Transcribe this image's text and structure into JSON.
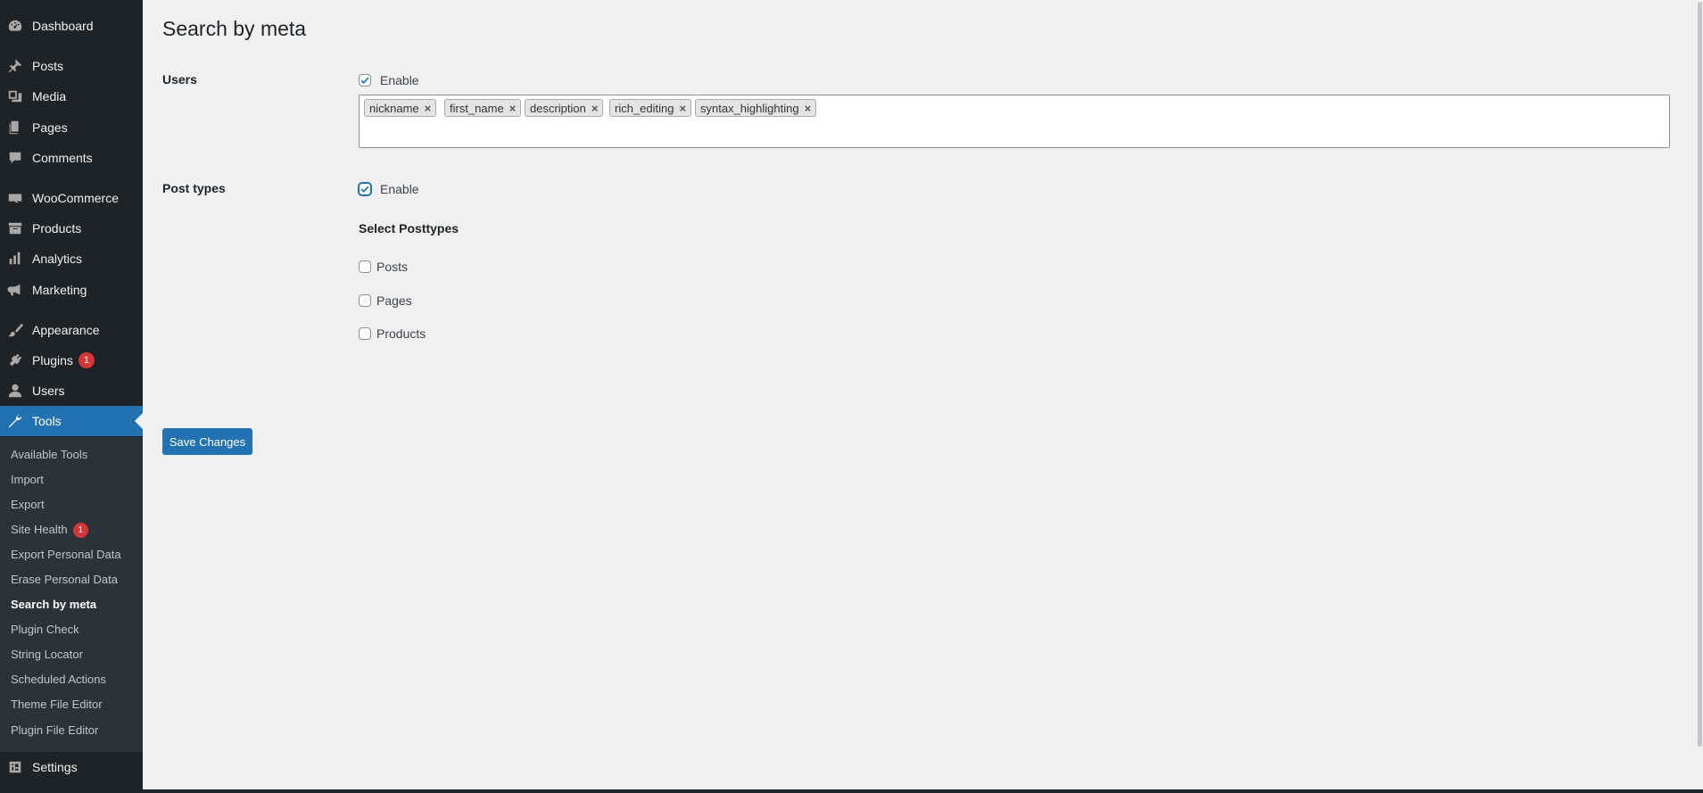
{
  "sidebar": {
    "items": [
      {
        "label": "Dashboard",
        "icon": "dashboard-icon"
      },
      {
        "label": "Posts",
        "icon": "pin-icon"
      },
      {
        "label": "Media",
        "icon": "media-icon"
      },
      {
        "label": "Pages",
        "icon": "pages-icon"
      },
      {
        "label": "Comments",
        "icon": "comment-icon"
      },
      {
        "label": "WooCommerce",
        "icon": "woo-icon"
      },
      {
        "label": "Products",
        "icon": "archive-icon"
      },
      {
        "label": "Analytics",
        "icon": "bar-chart-icon"
      },
      {
        "label": "Marketing",
        "icon": "megaphone-icon"
      },
      {
        "label": "Appearance",
        "icon": "brush-icon"
      },
      {
        "label": "Plugins",
        "icon": "plugin-icon",
        "badge": "1"
      },
      {
        "label": "Users",
        "icon": "user-icon"
      },
      {
        "label": "Tools",
        "icon": "wrench-icon",
        "current": true
      },
      {
        "label": "Settings",
        "icon": "settings-icon"
      }
    ],
    "submenu": [
      {
        "label": "Available Tools"
      },
      {
        "label": "Import"
      },
      {
        "label": "Export"
      },
      {
        "label": "Site Health",
        "badge": "1"
      },
      {
        "label": "Export Personal Data"
      },
      {
        "label": "Erase Personal Data"
      },
      {
        "label": "Search by meta",
        "current": true
      },
      {
        "label": "Plugin Check"
      },
      {
        "label": "String Locator"
      },
      {
        "label": "Scheduled Actions"
      },
      {
        "label": "Theme File Editor"
      },
      {
        "label": "Plugin File Editor"
      }
    ]
  },
  "page": {
    "title": "Search by meta",
    "users": {
      "label": "Users",
      "enable_label": "Enable",
      "enabled": true,
      "tags": [
        "nickname",
        "first_name",
        "description",
        "rich_editing",
        "syntax_highlighting"
      ],
      "remove_glyph": "×"
    },
    "post_types": {
      "label": "Post types",
      "enable_label": "Enable",
      "enabled": true,
      "select_label": "Select Posttypes",
      "options": [
        {
          "label": "Posts",
          "checked": false
        },
        {
          "label": "Pages",
          "checked": false
        },
        {
          "label": "Products",
          "checked": false
        }
      ]
    },
    "save_label": "Save Changes"
  },
  "colors": {
    "sidebar_bg": "#1d2327",
    "submenu_bg": "#2c3338",
    "accent": "#2271b1",
    "badge": "#d63638",
    "page_bg": "#f0f0f1"
  }
}
